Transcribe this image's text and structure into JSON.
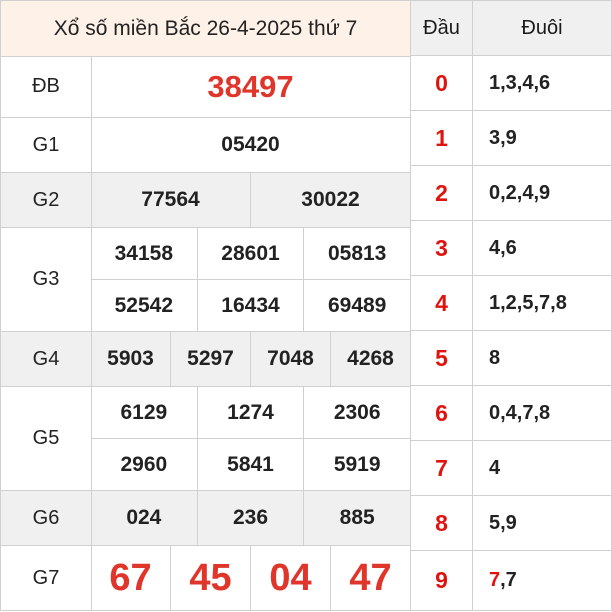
{
  "title": "Xổ số miền Bắc 26-4-2025 thứ 7",
  "prizes": [
    {
      "label": "ĐB",
      "lines": [
        [
          "38497"
        ]
      ]
    },
    {
      "label": "G1",
      "lines": [
        [
          "05420"
        ]
      ]
    },
    {
      "label": "G2",
      "lines": [
        [
          "77564",
          "30022"
        ]
      ]
    },
    {
      "label": "G3",
      "lines": [
        [
          "34158",
          "28601",
          "05813"
        ],
        [
          "52542",
          "16434",
          "69489"
        ]
      ]
    },
    {
      "label": "G4",
      "lines": [
        [
          "5903",
          "5297",
          "7048",
          "4268"
        ]
      ]
    },
    {
      "label": "G5",
      "lines": [
        [
          "6129",
          "1274",
          "2306"
        ],
        [
          "2960",
          "5841",
          "5919"
        ]
      ]
    },
    {
      "label": "G6",
      "lines": [
        [
          "024",
          "236",
          "885"
        ]
      ]
    },
    {
      "label": "G7",
      "lines": [
        [
          "67",
          "45",
          "04",
          "47"
        ]
      ]
    }
  ],
  "loto": {
    "head_label": "Đầu",
    "tail_label": "Đuôi",
    "rows": [
      {
        "dau": "0",
        "duoi": "1,3,4,6"
      },
      {
        "dau": "1",
        "duoi": "3,9"
      },
      {
        "dau": "2",
        "duoi": "0,2,4,9"
      },
      {
        "dau": "3",
        "duoi": "4,6"
      },
      {
        "dau": "4",
        "duoi": "1,2,5,7,8"
      },
      {
        "dau": "5",
        "duoi": "8"
      },
      {
        "dau": "6",
        "duoi": "0,4,7,8"
      },
      {
        "dau": "7",
        "duoi": "4"
      },
      {
        "dau": "8",
        "duoi": "5,9"
      },
      {
        "dau": "9",
        "duoi_red": "7",
        "duoi": ",7"
      }
    ]
  },
  "colors": {
    "accent_red": "#e0352b",
    "loto_red": "#e0140f",
    "title_bg": "#fdf1e8",
    "shade_bg": "#f0f0f0"
  }
}
